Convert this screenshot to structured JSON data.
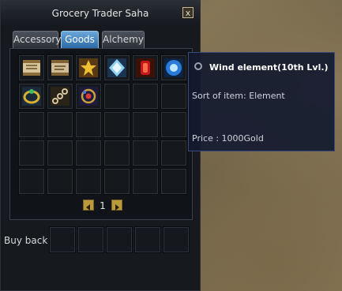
{
  "window": {
    "title": "Grocery Trader Saha",
    "close_label": "x"
  },
  "tabs": [
    {
      "label": "Accessory",
      "active": false
    },
    {
      "label": "Goods",
      "active": true
    },
    {
      "label": "Alchemy",
      "active": false
    }
  ],
  "items": [
    {
      "name": "scroll-icon"
    },
    {
      "name": "scroll-icon"
    },
    {
      "name": "star-element-icon"
    },
    {
      "name": "crystal-element-icon"
    },
    {
      "name": "red-gem-icon"
    },
    {
      "name": "wind-element-icon"
    },
    {
      "name": "ring-icon"
    },
    {
      "name": "chain-icon"
    },
    {
      "name": "amulet-icon"
    }
  ],
  "pager": {
    "page": "1"
  },
  "buyback": {
    "label": "Buy back"
  },
  "tooltip": {
    "title": "Wind element(10th Lvl.)",
    "sort": "Sort of item: Element",
    "price": "Price : 1000Gold"
  }
}
